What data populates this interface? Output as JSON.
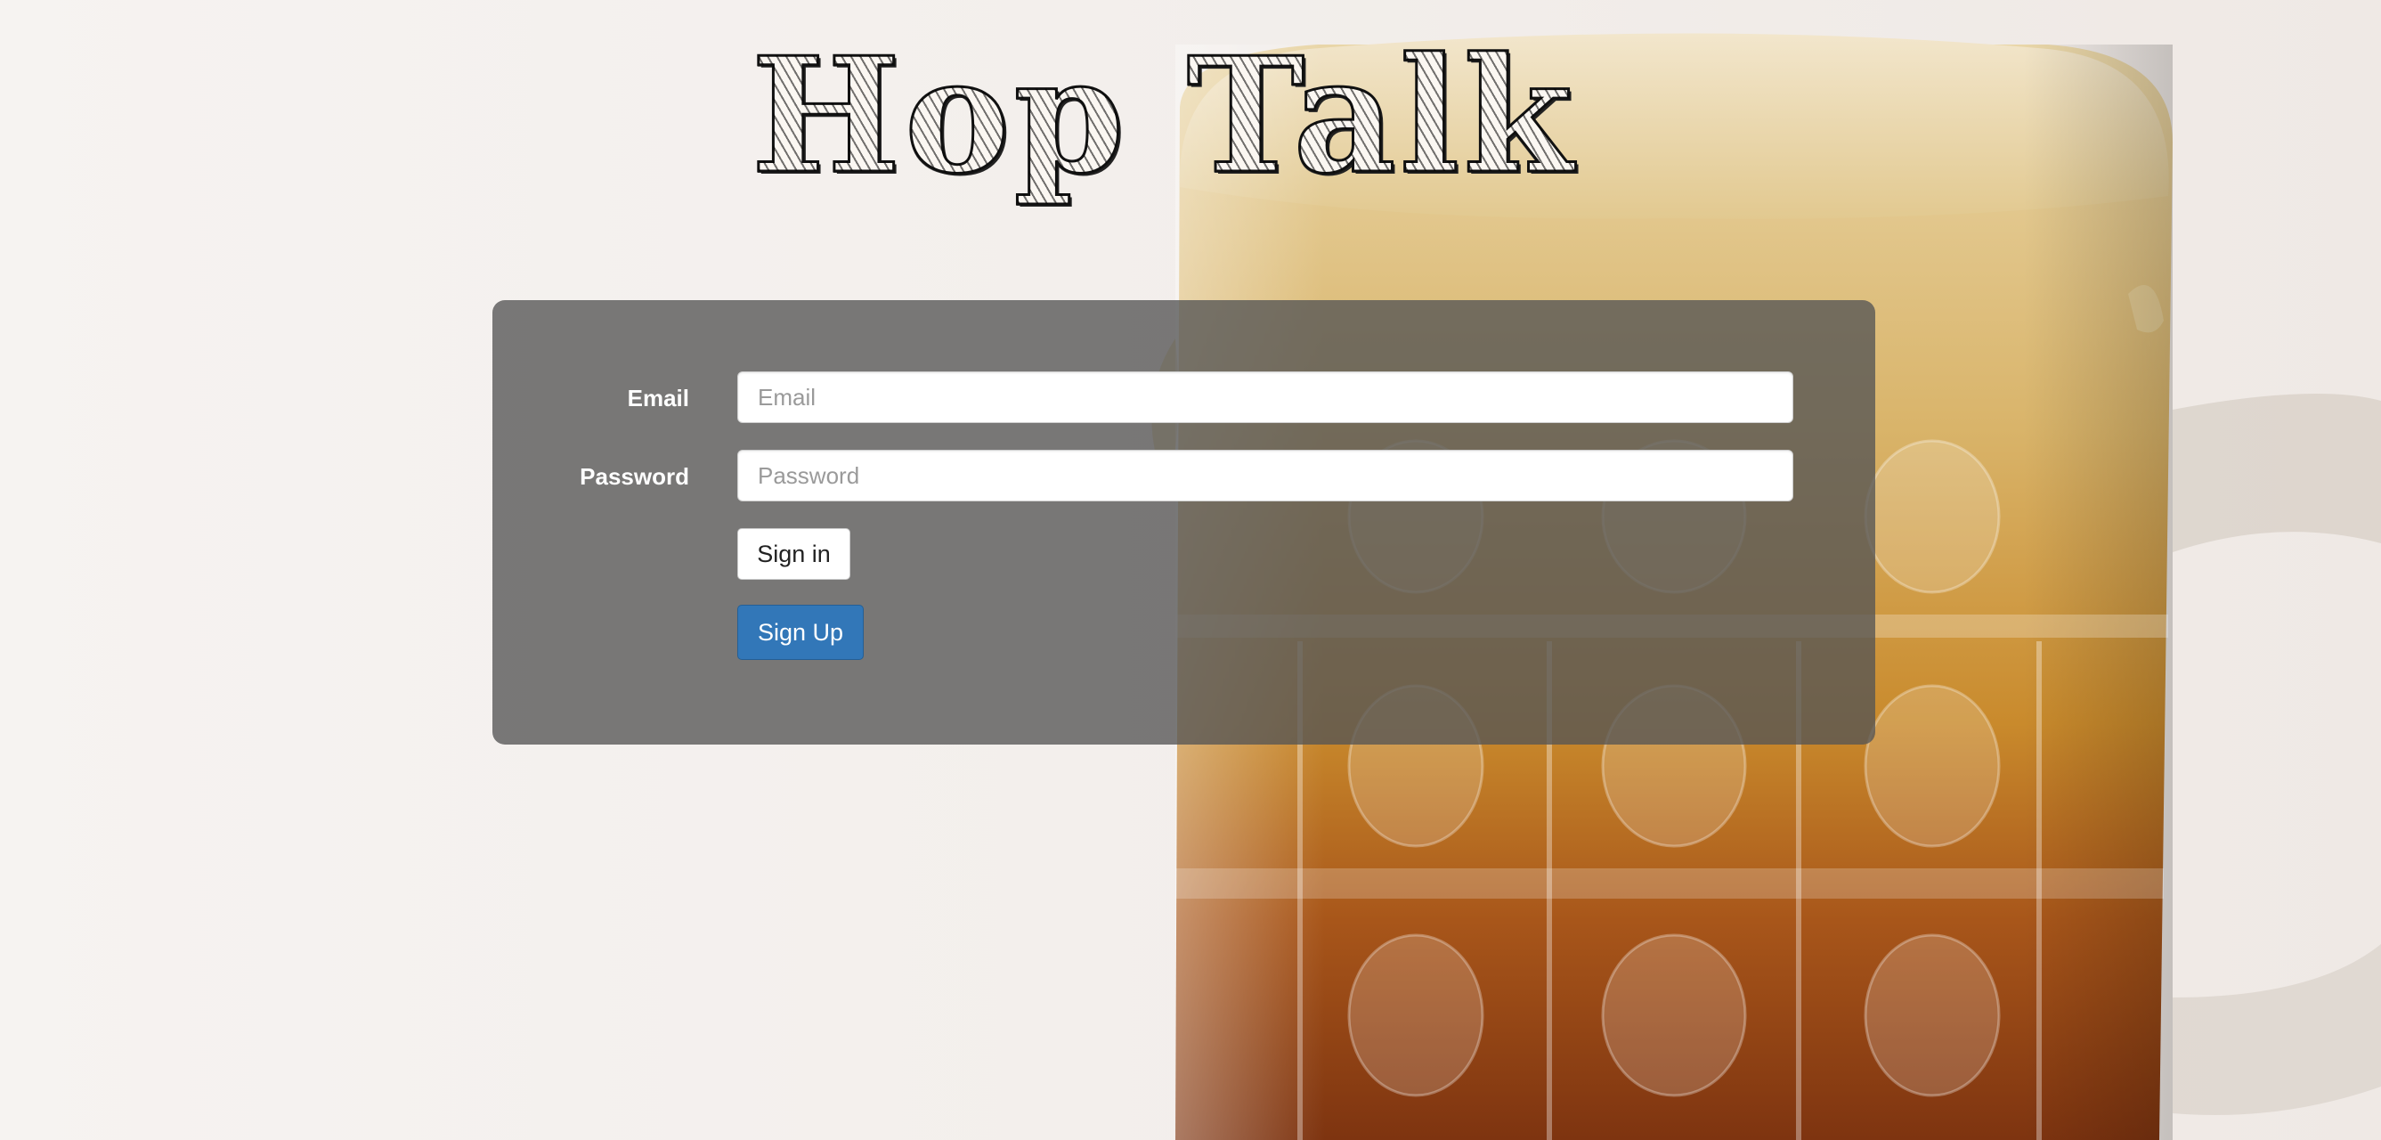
{
  "app": {
    "title": "Hop Talk"
  },
  "login_form": {
    "email_label": "Email",
    "email_placeholder": "Email",
    "email_value": "",
    "password_label": "Password",
    "password_placeholder": "Password",
    "password_value": "",
    "signin_label": "Sign in",
    "signup_label": "Sign Up"
  },
  "colors": {
    "panel_background": "#555555",
    "signup_button": "#3277b8",
    "page_background": "#f3efec"
  },
  "background": {
    "image": "beer-mug-image"
  }
}
